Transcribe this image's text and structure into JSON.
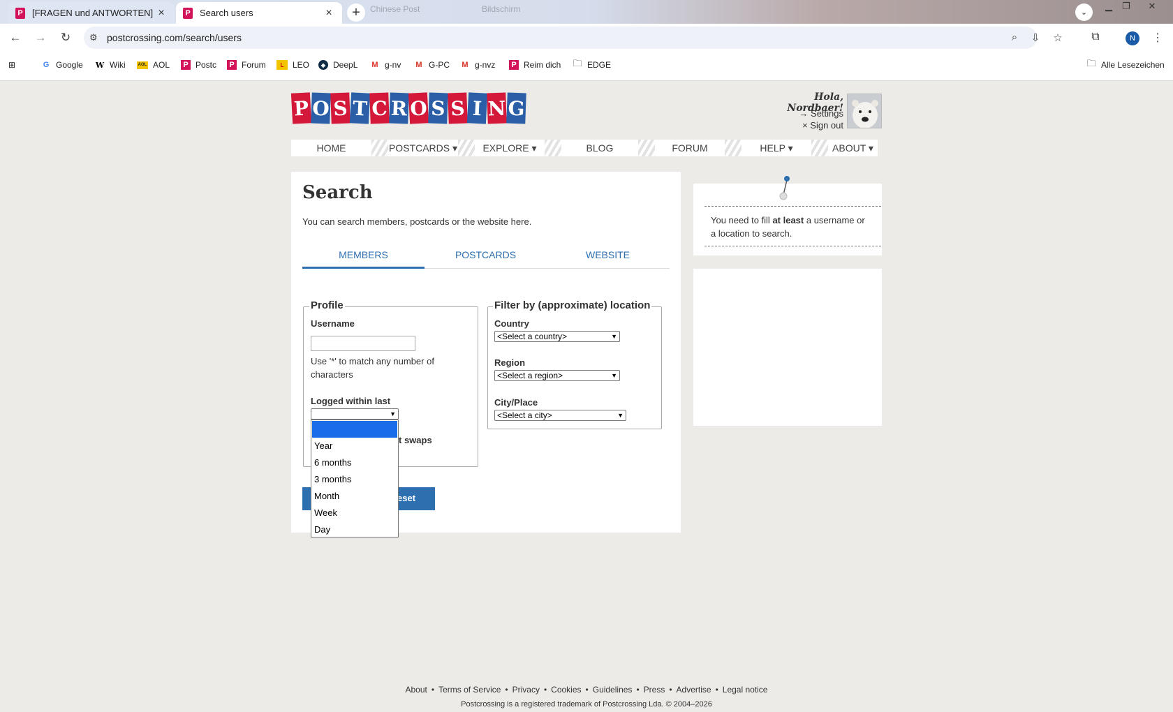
{
  "browser": {
    "tabs": [
      {
        "title": "[FRAGEN und ANTWORTEN] un",
        "active": false
      },
      {
        "title": "Search users",
        "active": true
      }
    ],
    "ghost_tabs": [
      "Chinese Post",
      "Bildschirm"
    ],
    "url": "postcrossing.com/search/users",
    "profile_initial": "N",
    "bookmarks": [
      {
        "label": "Google",
        "icon": "google-g"
      },
      {
        "label": "Wiki",
        "icon": "wikipedia-w"
      },
      {
        "label": "AOL",
        "icon": "aol-logo"
      },
      {
        "label": "Postc",
        "icon": "postcrossing-p"
      },
      {
        "label": "Forum",
        "icon": "postcrossing-p"
      },
      {
        "label": "LEO",
        "icon": "leo-logo"
      },
      {
        "label": "DeepL",
        "icon": "deepl-logo"
      },
      {
        "label": "g-nv",
        "icon": "gmail-m"
      },
      {
        "label": "G-PC",
        "icon": "gmail-m"
      },
      {
        "label": "g-nvz",
        "icon": "gmail-m"
      },
      {
        "label": "Reim dich",
        "icon": "postcrossing-p"
      },
      {
        "label": "EDGE",
        "icon": "folder"
      }
    ],
    "all_bookmarks": "Alle Lesezeichen"
  },
  "site": {
    "logo_letters": [
      "P",
      "O",
      "S",
      "T",
      "C",
      "R",
      "O",
      "S",
      "S",
      "I",
      "N",
      "G"
    ],
    "greeting": "Hola, Nordbaer!",
    "settings_link": "→ Settings",
    "signout_link": "× Sign out",
    "nav": [
      "HOME",
      "POSTCARDS ▾",
      "EXPLORE ▾",
      "BLOG",
      "FORUM",
      "HELP ▾",
      "ABOUT ▾"
    ],
    "brand_colors": {
      "red": "#d4183a",
      "blue": "#2a5fa8"
    }
  },
  "search": {
    "title": "Search",
    "intro": "You can search members, postcards or the website here.",
    "tabs": [
      "MEMBERS",
      "POSTCARDS",
      "WEBSITE"
    ],
    "profile": {
      "legend": "Profile",
      "username_label": "Username",
      "username_value": "",
      "hint": "Use '*' to match any number of characters",
      "logged_label": "Logged within last",
      "logged_value": "",
      "logged_options": [
        "",
        "Year",
        "6 months",
        "3 months",
        "Month",
        "Week",
        "Day"
      ],
      "swaps_partial": "t swaps"
    },
    "location": {
      "legend": "Filter by (approximate) location",
      "country_label": "Country",
      "country_value": "<Select a country>",
      "region_label": "Region",
      "region_value": "<Select a region>",
      "city_label": "City/Place",
      "city_value": "<Select a city>"
    },
    "reset_partial": "eset"
  },
  "sidebar": {
    "notice_prefix": "You need to fill ",
    "notice_bold": "at least",
    "notice_suffix": " a username or a location to search."
  },
  "footer": {
    "links": [
      "About",
      "Terms of Service",
      "Privacy",
      "Cookies",
      "Guidelines",
      "Press",
      "Advertise",
      "Legal notice"
    ],
    "trademark": "Postcrossing is a registered trademark of Postcrossing Lda. © 2004–2026"
  }
}
